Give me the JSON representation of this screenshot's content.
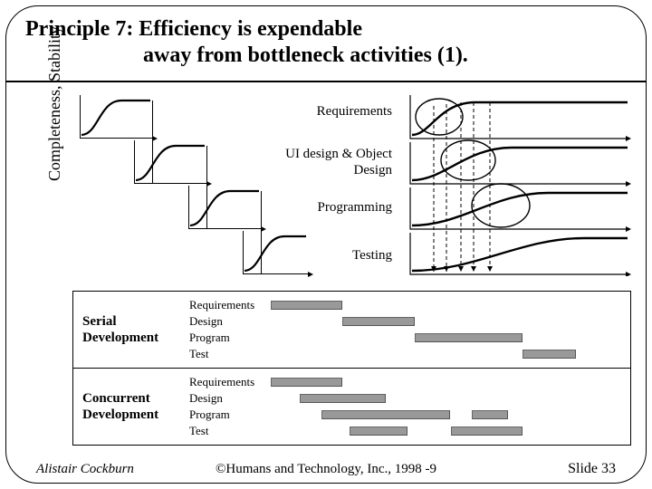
{
  "title": {
    "line1": "Principle 7: Efficiency is expendable",
    "line2": "away from bottleneck activities (1)."
  },
  "y_axis_label": "Completeness, Stability",
  "row_labels": {
    "r1": "Requirements",
    "r2": "UI design & Object Design",
    "r3": "Programming",
    "r4": "Testing"
  },
  "table": {
    "serial": {
      "title": "Serial Development",
      "rows": [
        "Requirements",
        "Design",
        "Program",
        "Test"
      ]
    },
    "concurrent": {
      "title": "Concurrent Development",
      "rows": [
        "Requirements",
        "Design",
        "Program",
        "Test"
      ]
    }
  },
  "footer": {
    "left": "Alistair Cockburn",
    "center": "©Humans and Technology, Inc., 1998 -9",
    "right": "Slide 33"
  },
  "chart_data": {
    "type": "diagram",
    "title": "S-curves of completeness/stability per activity",
    "ylabel": "Completeness, Stability",
    "left_panel": {
      "description": "Serial — each activity's S-curve starts after prior one finishes",
      "activities": [
        "Requirements",
        "UI design & Object Design",
        "Programming",
        "Testing"
      ]
    },
    "right_panel": {
      "description": "Concurrent — S-curves overlap; downstream activities share info early (dashed drops)",
      "activities": [
        "Requirements",
        "UI design & Object Design",
        "Programming",
        "Testing"
      ]
    },
    "gantt": {
      "serial": [
        {
          "name": "Requirements",
          "bars": [
            [
              0,
              20
            ]
          ]
        },
        {
          "name": "Design",
          "bars": [
            [
              20,
              40
            ]
          ]
        },
        {
          "name": "Program",
          "bars": [
            [
              40,
              70
            ]
          ]
        },
        {
          "name": "Test",
          "bars": [
            [
              70,
              85
            ]
          ]
        }
      ],
      "concurrent": [
        {
          "name": "Requirements",
          "bars": [
            [
              0,
              20
            ]
          ]
        },
        {
          "name": "Design",
          "bars": [
            [
              8,
              32
            ]
          ]
        },
        {
          "name": "Program",
          "bars": [
            [
              14,
              50
            ],
            [
              56,
              66
            ]
          ]
        },
        {
          "name": "Test",
          "bars": [
            [
              22,
              38
            ],
            [
              50,
              70
            ]
          ]
        }
      ]
    }
  }
}
